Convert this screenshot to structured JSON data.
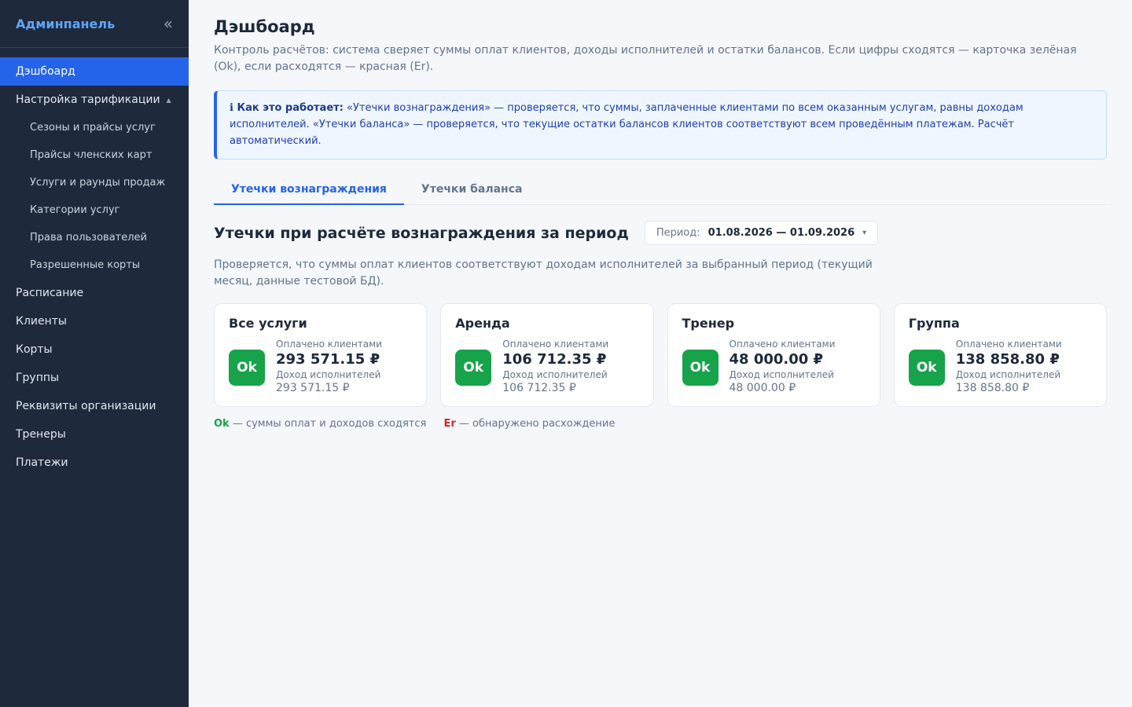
{
  "sidebar": {
    "brand": "Админпанель",
    "collapse": "«",
    "items": [
      {
        "label": "Дэшбоард"
      },
      {
        "label": "Настройка тарификации",
        "caret": "▲"
      },
      {
        "label": "Сезоны и прайсы услуг"
      },
      {
        "label": "Прайсы членских карт"
      },
      {
        "label": "Услуги и раунды продаж"
      },
      {
        "label": "Категории услуг"
      },
      {
        "label": "Права пользователей"
      },
      {
        "label": "Разрешенные корты"
      },
      {
        "label": "Расписание"
      },
      {
        "label": "Клиенты"
      },
      {
        "label": "Корты"
      },
      {
        "label": "Группы"
      },
      {
        "label": "Реквизиты организации"
      },
      {
        "label": "Тренеры"
      },
      {
        "label": "Платежи"
      }
    ]
  },
  "main": {
    "title": "Дэшбоард",
    "description": "Контроль расчётов: система сверяет суммы оплат клиентов, доходы исполнителей и остатки балансов. Если цифры сходятся — карточка зелёная (Ok), если расходятся — красная (Er).",
    "info": {
      "icon": "ℹ",
      "heading": "Как это работает:",
      "text": "«Утечки вознаграждения» — проверяется, что суммы, заплаченные клиентами по всем оказанным услугам, равны доходам исполнителей. «Утечки баланса» — проверяется, что текущие остатки балансов клиентов соответствуют всем проведённым платежам. Расчёт автоматический."
    },
    "tabs": [
      {
        "label": "Утечки вознаграждения"
      },
      {
        "label": "Утечки баланса"
      }
    ],
    "section": {
      "title": "Утечки при расчёте вознаграждения за период",
      "period_label": "Период:",
      "period_value": "01.08.2026 — 01.09.2026",
      "period_caret": "▾",
      "description": "Проверяется, что суммы оплат клиентов соответствуют доходам исполнителей за выбранный период (текущий месяц, данные тестовой БД)."
    },
    "cards": [
      {
        "title": "Все услуги",
        "status": "Ok",
        "paid_label": "Оплачено клиентами",
        "paid": "293 571.15 ₽",
        "income_label": "Доход исполнителей",
        "income": "293 571.15 ₽"
      },
      {
        "title": "Аренда",
        "status": "Ok",
        "paid_label": "Оплачено клиентами",
        "paid": "106 712.35 ₽",
        "income_label": "Доход исполнителей",
        "income": "106 712.35 ₽"
      },
      {
        "title": "Тренер",
        "status": "Ok",
        "paid_label": "Оплачено клиентами",
        "paid": "48 000.00 ₽",
        "income_label": "Доход исполнителей",
        "income": "48 000.00 ₽"
      },
      {
        "title": "Группа",
        "status": "Ok",
        "paid_label": "Оплачено клиентами",
        "paid": "138 858.80 ₽",
        "income_label": "Доход исполнителей",
        "income": "138 858.80 ₽"
      }
    ],
    "legend": {
      "ok": "Ok",
      "ok_text": " — суммы оплат и доходов сходятся",
      "er": "Er",
      "er_text": " — обнаружено расхождение"
    }
  },
  "colors": {
    "sidebar_bg": "#1e293b",
    "accent": "#2563eb",
    "ok": "#16a34a",
    "er": "#dc2626"
  }
}
